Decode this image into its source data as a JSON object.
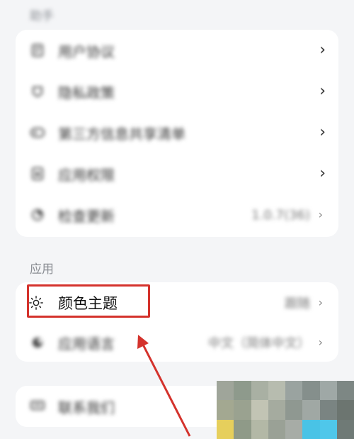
{
  "top_section": {
    "label": "助手"
  },
  "card1": {
    "items": [
      {
        "icon": "document-icon",
        "label": "用户协议",
        "value": ""
      },
      {
        "icon": "privacy-icon",
        "label": "隐私政策",
        "value": ""
      },
      {
        "icon": "share-list-icon",
        "label": "第三方信息共享清单",
        "value": ""
      },
      {
        "icon": "permission-icon",
        "label": "应用权限",
        "value": ""
      },
      {
        "icon": "update-icon",
        "label": "检查更新",
        "value": "1.0.7(36)"
      }
    ]
  },
  "app_section": {
    "label": "应用"
  },
  "card2": {
    "items": [
      {
        "icon": "sun-icon",
        "label": "颜色主题",
        "value": "跟随"
      },
      {
        "icon": "language-icon",
        "label": "应用语言",
        "value": "中文（简体中文）"
      }
    ]
  },
  "card3": {
    "items": [
      {
        "icon": "feedback-icon",
        "label": "联系我们",
        "value": ""
      }
    ]
  },
  "colors": {
    "annotation": "#d4322c",
    "background": "#f4f5f7",
    "card": "#ffffff"
  }
}
